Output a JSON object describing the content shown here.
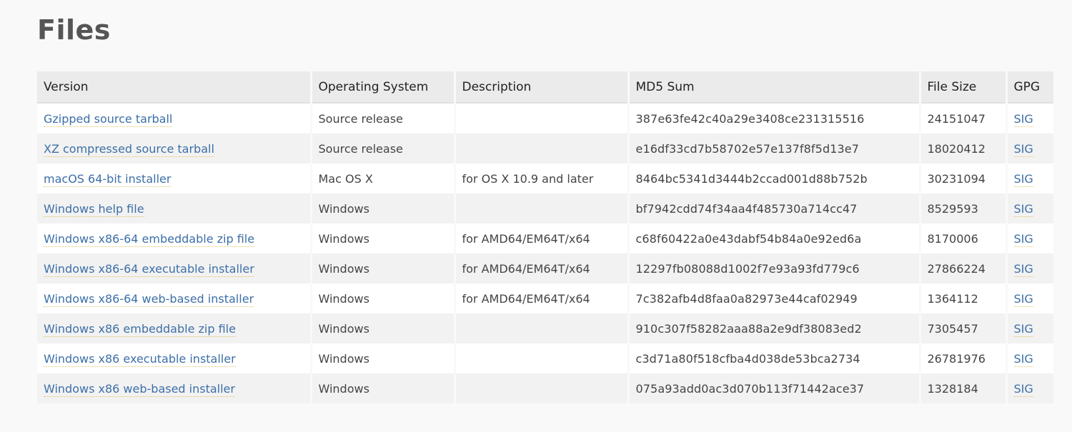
{
  "title": "Files",
  "columns": {
    "version": "Version",
    "os": "Operating System",
    "description": "Description",
    "md5": "MD5 Sum",
    "size": "File Size",
    "gpg": "GPG"
  },
  "rows": [
    {
      "version": "Gzipped source tarball",
      "os": "Source release",
      "description": "",
      "md5": "387e63fe42c40a29e3408ce231315516",
      "size": "24151047",
      "gpg": "SIG"
    },
    {
      "version": "XZ compressed source tarball",
      "os": "Source release",
      "description": "",
      "md5": "e16df33cd7b58702e57e137f8f5d13e7",
      "size": "18020412",
      "gpg": "SIG"
    },
    {
      "version": "macOS 64-bit installer",
      "os": "Mac OS X",
      "description": "for OS X 10.9 and later",
      "md5": "8464bc5341d3444b2ccad001d88b752b",
      "size": "30231094",
      "gpg": "SIG"
    },
    {
      "version": "Windows help file",
      "os": "Windows",
      "description": "",
      "md5": "bf7942cdd74f34aa4f485730a714cc47",
      "size": "8529593",
      "gpg": "SIG"
    },
    {
      "version": "Windows x86-64 embeddable zip file",
      "os": "Windows",
      "description": "for AMD64/EM64T/x64",
      "md5": "c68f60422a0e43dabf54b84a0e92ed6a",
      "size": "8170006",
      "gpg": "SIG"
    },
    {
      "version": "Windows x86-64 executable installer",
      "os": "Windows",
      "description": "for AMD64/EM64T/x64",
      "md5": "12297fb08088d1002f7e93a93fd779c6",
      "size": "27866224",
      "gpg": "SIG"
    },
    {
      "version": "Windows x86-64 web-based installer",
      "os": "Windows",
      "description": "for AMD64/EM64T/x64",
      "md5": "7c382afb4d8faa0a82973e44caf02949",
      "size": "1364112",
      "gpg": "SIG"
    },
    {
      "version": "Windows x86 embeddable zip file",
      "os": "Windows",
      "description": "",
      "md5": "910c307f58282aaa88a2e9df38083ed2",
      "size": "7305457",
      "gpg": "SIG"
    },
    {
      "version": "Windows x86 executable installer",
      "os": "Windows",
      "description": "",
      "md5": "c3d71a80f518cfba4d038de53bca2734",
      "size": "26781976",
      "gpg": "SIG"
    },
    {
      "version": "Windows x86 web-based installer",
      "os": "Windows",
      "description": "",
      "md5": "075a93add0ac3d070b113f71442ace37",
      "size": "1328184",
      "gpg": "SIG"
    }
  ],
  "colors": {
    "link": "#3c6fa7",
    "link_underline": "#e0c36a",
    "header_bg": "#ebebeb",
    "row_alt_bg": "#f2f2f2",
    "page_bg": "#f9f9f9"
  }
}
